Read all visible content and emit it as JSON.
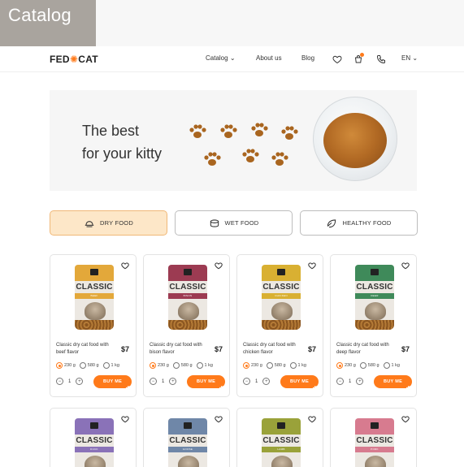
{
  "overlay": {
    "label": "Catalog"
  },
  "header": {
    "logo_left": "FED",
    "logo_right": "CAT",
    "nav": {
      "catalog": "Catalog",
      "about": "About us",
      "blog": "Blog"
    },
    "lang": "EN",
    "icons": [
      "heart-icon",
      "cart-icon",
      "phone-icon",
      "chevron-down-icon"
    ]
  },
  "hero": {
    "title_line1": "The best",
    "title_line2": "for your kitty"
  },
  "tabs": [
    {
      "label": "DRY FOOD",
      "active": true,
      "icon": "bowl-icon"
    },
    {
      "label": "WET FOOD",
      "active": false,
      "icon": "can-icon"
    },
    {
      "label": "HEALTHY FOOD",
      "active": false,
      "icon": "leaf-icon"
    }
  ],
  "products": [
    {
      "bag_title": "CLASSIC",
      "flavor_tag": "BEEF",
      "name": "Classic dry cat food with beef flavor",
      "price": "$7",
      "accent": "#e3a83a",
      "weights": [
        "230 g",
        "580 g",
        "1 kg"
      ],
      "qty": "1",
      "buy": "BUY ME"
    },
    {
      "bag_title": "CLASSIC",
      "flavor_tag": "BISON",
      "name": "Classic dry cat food with bison flavor",
      "price": "$7",
      "accent": "#9c3b52",
      "weights": [
        "230 g",
        "580 g",
        "1 kg"
      ],
      "qty": "1",
      "buy": "BUY ME"
    },
    {
      "bag_title": "CLASSIC",
      "flavor_tag": "CHICKEN",
      "name": "Classic dry cat food with chicken flavor",
      "price": "$7",
      "accent": "#d9b032",
      "weights": [
        "230 g",
        "580 g",
        "1 kg"
      ],
      "qty": "1",
      "buy": "BUY ME"
    },
    {
      "bag_title": "CLASSIC",
      "flavor_tag": "DEER",
      "name": "Classic dry cat food with deep flavor",
      "price": "$7",
      "accent": "#3f8a5a",
      "weights": [
        "230 g",
        "580 g",
        "1 kg"
      ],
      "qty": "1",
      "buy": "BUY ME"
    },
    {
      "bag_title": "CLASSIC",
      "flavor_tag": "DUCK",
      "accent": "#8a72b8"
    },
    {
      "bag_title": "CLASSIC",
      "flavor_tag": "GOOSE",
      "accent": "#6f87a8"
    },
    {
      "bag_title": "CLASSIC",
      "flavor_tag": "LAMB",
      "accent": "#9aa23a"
    },
    {
      "bag_title": "CLASSIC",
      "flavor_tag": "PORK",
      "accent": "#d77b8f"
    }
  ],
  "colors": {
    "accent": "#ff7a1a",
    "active_tab_bg": "#fde7c8"
  }
}
